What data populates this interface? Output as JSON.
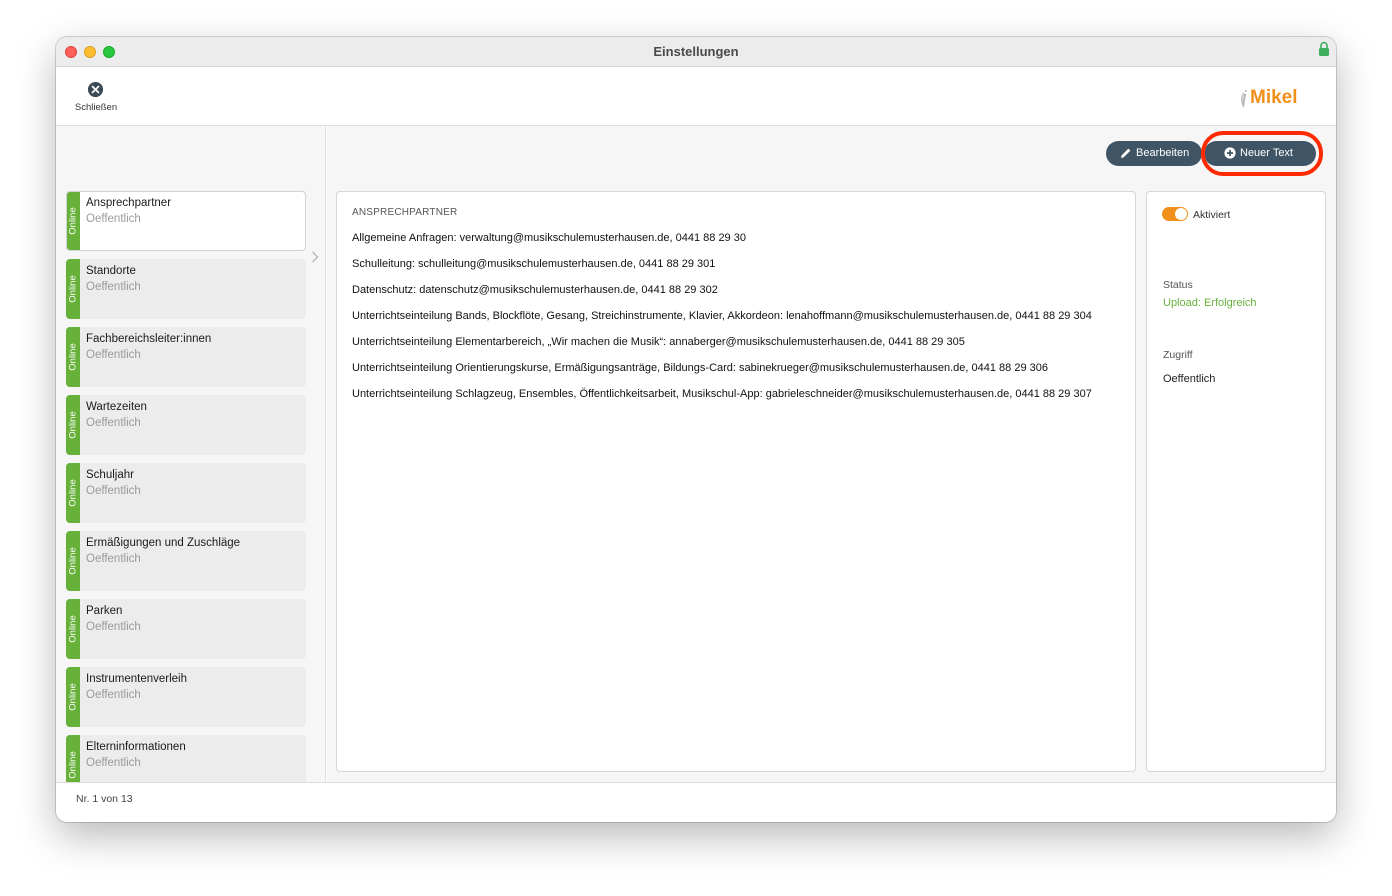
{
  "window": {
    "title": "Einstellungen"
  },
  "toolbar": {
    "close_label": "Schließen",
    "logo_text": "Mikel",
    "logo_i": "i"
  },
  "sidebar": {
    "badge_label": "Online",
    "items": [
      {
        "title": "Ansprechpartner",
        "subtitle": "Oeffentlich"
      },
      {
        "title": "Standorte",
        "subtitle": "Oeffentlich"
      },
      {
        "title": "Fachbereichsleiter:innen",
        "subtitle": "Oeffentlich"
      },
      {
        "title": "Wartezeiten",
        "subtitle": "Oeffentlich"
      },
      {
        "title": "Schuljahr",
        "subtitle": "Oeffentlich"
      },
      {
        "title": "Ermäßigungen und Zuschläge",
        "subtitle": "Oeffentlich"
      },
      {
        "title": "Parken",
        "subtitle": "Oeffentlich"
      },
      {
        "title": "Instrumentenverleih",
        "subtitle": "Oeffentlich"
      },
      {
        "title": "Elterninformationen",
        "subtitle": "Oeffentlich"
      }
    ]
  },
  "actions": {
    "edit_label": "Bearbeiten",
    "new_label": "Neuer Text"
  },
  "content": {
    "heading": "ANSPRECHPARTNER",
    "lines": [
      "Allgemeine Anfragen: verwaltung@musikschulemusterhausen.de, 0441 88 29 30",
      "Schulleitung: schulleitung@musikschulemusterhausen.de, 0441 88 29 301",
      "Datenschutz: datenschutz@musikschulemusterhausen.de, 0441 88 29 302",
      "Unterrichtseinteilung Bands, Blockflöte, Gesang, Streichinstrumente, Klavier, Akkordeon: lenahoffmann@musikschulemusterhausen.de, 0441 88 29 304",
      "Unterrichtseinteilung Elementarbereich, „Wir machen die Musik“: annaberger@musikschulemusterhausen.de, 0441 88 29 305",
      "Unterrichtseinteilung Orientierungskurse, Ermäßigungsanträge, Bildungs-Card: sabinekrueger@musikschulemusterhausen.de, 0441 88 29 306",
      "Unterrichtseinteilung Schlagzeug, Ensembles, Öffentlichkeitsarbeit, Musikschul-App: gabrieleschneider@musikschulemusterhausen.de, 0441 88 29 307"
    ]
  },
  "details": {
    "toggle_label": "Aktiviert",
    "toggle_on": true,
    "status_label": "Status",
    "status_value": "Upload: Erfolgreich",
    "access_label": "Zugriff",
    "access_value": "Oeffentlich"
  },
  "statusbar": {
    "record_text": "Nr. 1 von 13"
  },
  "colors": {
    "online_badge": "#67b13a",
    "button": "#3f5566",
    "toggle": "#f0901a",
    "highlight": "#ff2a00",
    "status_ok": "#67b13a",
    "logo_orange": "#f0901a"
  }
}
